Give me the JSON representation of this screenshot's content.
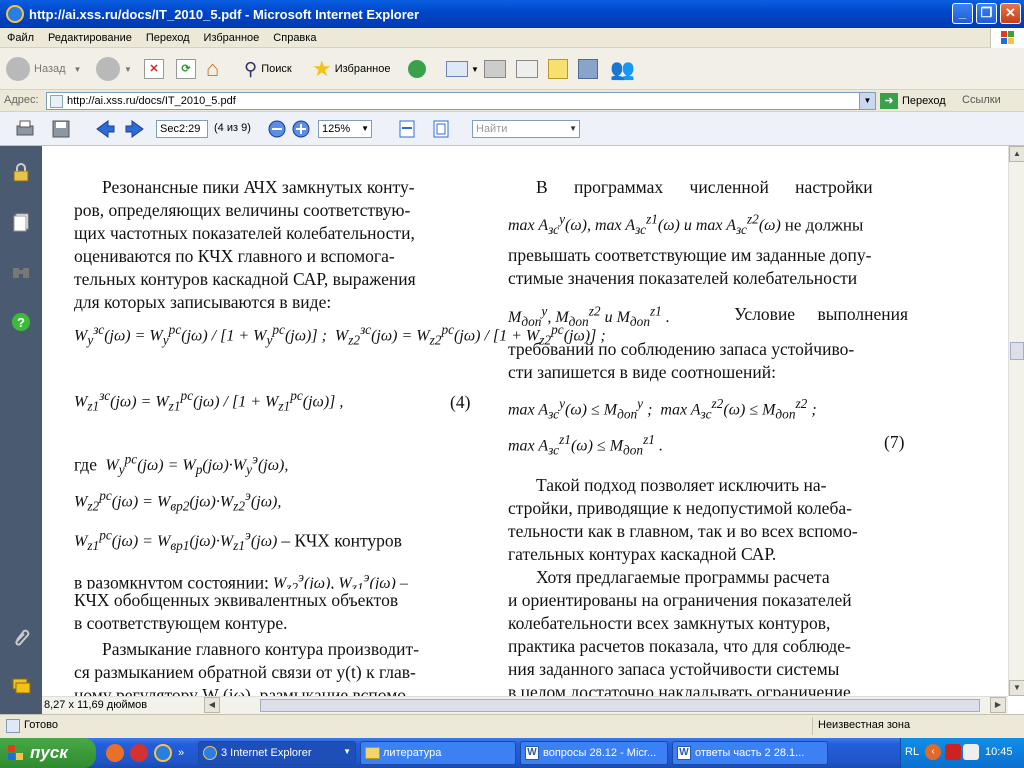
{
  "window": {
    "title": "http://ai.xss.ru/docs/IT_2010_5.pdf - Microsoft Internet Explorer"
  },
  "menu": [
    "Файл",
    "Редактирование",
    "Переход",
    "Избранное",
    "Справка"
  ],
  "toolbar": {
    "back": "Назад",
    "search": "Поиск",
    "favorites": "Избранное"
  },
  "address": {
    "label": "Адрес:",
    "url": "http://ai.xss.ru/docs/IT_2010_5.pdf",
    "go": "Переход",
    "links": "Ссылки"
  },
  "pdf": {
    "page_field": "Sec2:29",
    "page_count": "(4 из 9)",
    "zoom": "125%",
    "find_placeholder": "Найти"
  },
  "document": {
    "left_col": {
      "p1": [
        "Резонансные пики АЧХ замкнутых конту-",
        "ров, определяющих величины соответствую-",
        "щих частотных показателей колебательности,",
        "оцениваются по КЧХ главного и вспомога-",
        "тельных контуров каскадной САР, выражения",
        "для которых записываются в виде:"
      ],
      "eq4_label": "(4)",
      "where": "где",
      "kchx_contours": "– КЧХ контуров",
      "p2": [
        "в разомкнутом состоянии;",
        "КЧХ обобщенных эквивалентных объектов",
        "в соответствующем контуре."
      ],
      "p3": [
        "Размыкание главного контура производит-",
        "ся размыканием обратной связи от y(t) к глав-",
        "ному регулятору W (jω), размыкание вспомо-"
      ]
    },
    "right_col": {
      "p1_first": "В программах численной настройки",
      "p1_cont": "не должны",
      "p1_lines": [
        "превышать соответствующие им заданные допу-",
        "стимые значения показателей колебательности"
      ],
      "cond": "Условие выполнения",
      "p1_end": [
        "требований по соблюдению запаса устойчиво-",
        "сти запишется в виде соотношений:"
      ],
      "eq7_label": "(7)",
      "p2": [
        "Такой подход позволяет исключить на-",
        "стройки, приводящие к недопустимой колеба-",
        "тельности как в главном, так и во всех вспомо-",
        "гательных контурах каскадной САР."
      ],
      "p3": [
        "Хотя предлагаемые программы расчета",
        "и ориентированы на ограничения показателей",
        "колебательности всех замкнутых контуров,",
        "практика расчетов показала, что для соблюде-",
        "ния заданного запаса устойчивости системы",
        "в целом достаточно накладывать ограничение"
      ]
    }
  },
  "page_size": "8,27 x 11,69 дюймов",
  "status": {
    "left": "Готово",
    "zone": "Неизвестная зона"
  },
  "taskbar": {
    "start": "пуск",
    "tasks": [
      "3 Internet Explorer",
      "литература",
      "вопросы 28.12 - Micr...",
      "ответы часть 2 28.1..."
    ],
    "lang": "RL",
    "clock": "10:45"
  }
}
